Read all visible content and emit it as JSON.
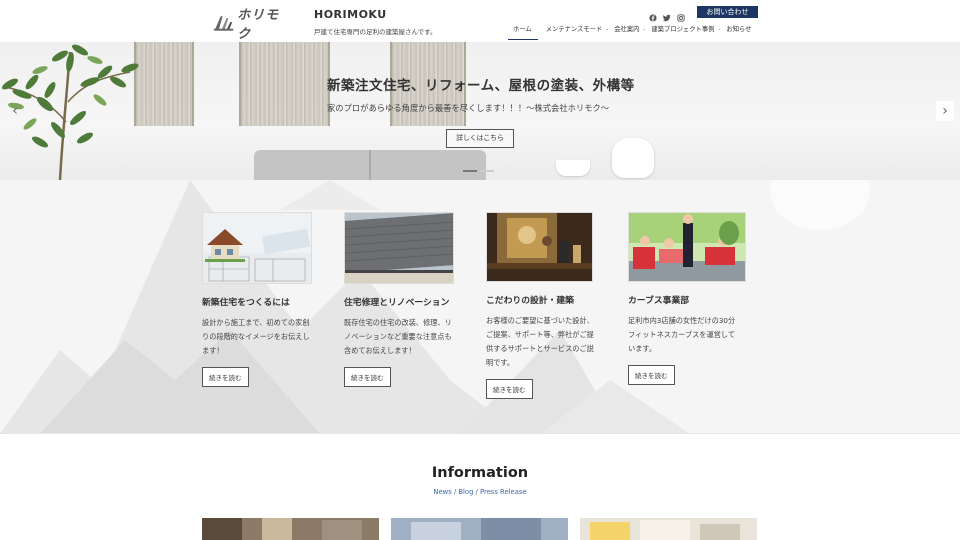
{
  "header": {
    "logo_text": "ホリモク",
    "site_title": "HORIMOKU",
    "site_description": "戸建て住宅専門の足利の建築屋さんです。",
    "contact_button": "お問い合わせ",
    "social_icons": [
      "facebook-icon",
      "twitter-icon",
      "instagram-icon"
    ],
    "nav": [
      {
        "label": "ホーム",
        "active": true
      },
      {
        "label": "メンテナンスモード"
      },
      {
        "label": "会社案内"
      },
      {
        "label": "建築プロジェクト事例"
      },
      {
        "label": "お知らせ"
      }
    ],
    "accent_color": "#1e3762"
  },
  "hero": {
    "title": "新築注文住宅、リフォーム、屋根の塗装、外構等",
    "subtitle": "家のプロがあらゆる角度から最善を尽くします！！！～株式会社ホリモク～",
    "button": "詳しくはこちら",
    "prev_arrow": "‹",
    "next_arrow": "›"
  },
  "features": [
    {
      "title": "新築住宅をつくるには",
      "text": "設計から施工まで、初めての家創りの段階的なイメージをお伝えします！",
      "button": "続きを読む"
    },
    {
      "title": "住宅修理とリノベーション",
      "text": "既存住宅の住宅の改装、修理、リノベーションなど重要な注意点も含めてお伝えします！",
      "button": "続きを読む"
    },
    {
      "title": "こだわりの設計・建築",
      "text": "お客様のご要望に基づいた設計、ご提案、サポート等、弊社がご提供するサポートとサービスのご説明です。",
      "button": "続きを読む"
    },
    {
      "title": "カーブス事業部",
      "text": "足利市内3店舗の女性だけの30分フィットネスカーブスを運営しています。",
      "button": "続きを読む"
    }
  ],
  "information": {
    "title": "Information",
    "subtitle": "News / Blog / Press Release"
  }
}
